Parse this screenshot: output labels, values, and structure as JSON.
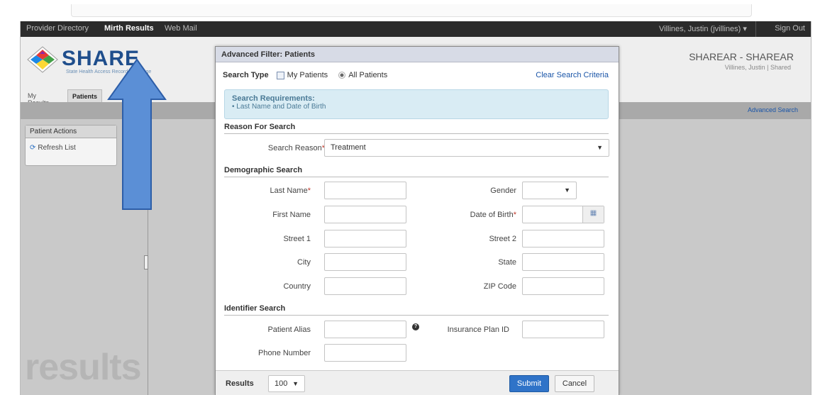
{
  "topnav": {
    "items": [
      "Provider Directory",
      "Mirth Results",
      "Web Mail"
    ],
    "active_item": "Mirth Results",
    "user_menu": "Villines, Justin (jvillines) ▾",
    "sign_out": "Sign Out"
  },
  "header": {
    "logo_text": "SHARE",
    "logo_sub": "State Health Access Record Exchange",
    "org_name": "SHAREAR - SHAREAR",
    "org_user": "Villines, Justin  |  Shared"
  },
  "tabs": [
    "My Results",
    "Patients"
  ],
  "toolbar": {
    "advanced_search": "Advanced Search"
  },
  "left_panel": {
    "actions_title": "Patient Actions",
    "refresh_label": "Refresh List",
    "watermark": "results"
  },
  "modal": {
    "title": "Advanced Filter: Patients",
    "search_type_label": "Search Type",
    "my_patients": "My Patients",
    "all_patients": "All Patients",
    "clear_criteria": "Clear Search Criteria",
    "requirements_title": "Search Requirements:",
    "requirements_item": "• Last Name and Date of Birth",
    "reason_section": "Reason For Search",
    "search_reason_label": "Search Reason",
    "search_reason_value": "Treatment",
    "demographic_section": "Demographic Search",
    "last_name": "Last Name",
    "first_name": "First Name",
    "street1": "Street 1",
    "city": "City",
    "country": "Country",
    "gender": "Gender",
    "dob": "Date of Birth",
    "street2": "Street 2",
    "state": "State",
    "zip": "ZIP Code",
    "identifier_section": "Identifier Search",
    "patient_alias": "Patient Alias",
    "phone_number": "Phone Number",
    "insurance_plan_id": "Insurance Plan ID",
    "results_label": "Results",
    "results_value": "100",
    "submit": "Submit",
    "cancel": "Cancel"
  },
  "colors": {
    "accent": "#2f73c8",
    "nav_bg": "#2b2b2b",
    "arrow": "#5b8fd6"
  }
}
